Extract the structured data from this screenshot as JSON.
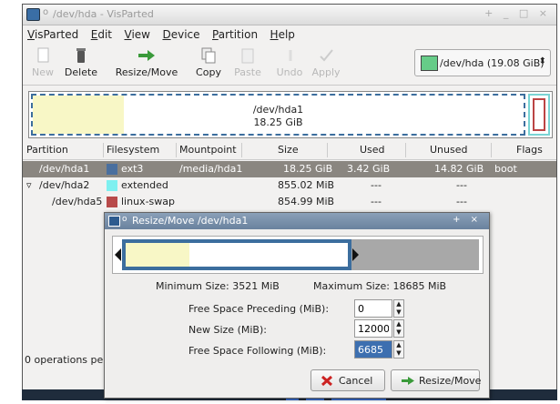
{
  "window": {
    "title": "/dev/hda - VisParted",
    "controls": "+ _ □ ×"
  },
  "menu": [
    "VisParted",
    "Edit",
    "View",
    "Device",
    "Partition",
    "Help"
  ],
  "toolbar": {
    "new": "New",
    "delete": "Delete",
    "resize_move": "Resize/Move",
    "copy": "Copy",
    "paste": "Paste",
    "undo": "Undo",
    "apply": "Apply"
  },
  "device_selector": "/dev/hda  (19.08 GiB)",
  "disk_map": {
    "partition": "/dev/hda1",
    "size": "18.25 GiB"
  },
  "columns": [
    "Partition",
    "Filesystem",
    "Mountpoint",
    "Size",
    "Used",
    "Unused",
    "Flags"
  ],
  "rows": [
    {
      "partition": "/dev/hda1",
      "filesystem": "ext3",
      "mountpoint": "/media/hda1",
      "size": "18.25 GiB",
      "used": "3.42 GiB",
      "unused": "14.82 GiB",
      "flags": "boot",
      "color": "#4a6f9e"
    },
    {
      "partition": "/dev/hda2",
      "filesystem": "extended",
      "mountpoint": "",
      "size": "855.02 MiB",
      "used": "---",
      "unused": "---",
      "flags": "",
      "color": "#7ef0f0"
    },
    {
      "partition": "/dev/hda5",
      "filesystem": "linux-swap",
      "mountpoint": "",
      "size": "854.99 MiB",
      "used": "---",
      "unused": "---",
      "flags": "",
      "color": "#b84a4a"
    }
  ],
  "status": "0 operations pe",
  "dialog": {
    "title": "Resize/Move /dev/hda1",
    "controls": "+ ×",
    "min_size": "Minimum Size: 3521 MiB",
    "max_size": "Maximum Size: 18685 MiB",
    "free_preceding_label": "Free Space Preceding (MiB):",
    "free_preceding_value": "0",
    "new_size_label": "New Size (MiB):",
    "new_size_value": "12000",
    "free_following_label": "Free Space Following (MiB):",
    "free_following_value": "6685",
    "cancel": "Cancel",
    "resize_move": "Resize/Move"
  }
}
